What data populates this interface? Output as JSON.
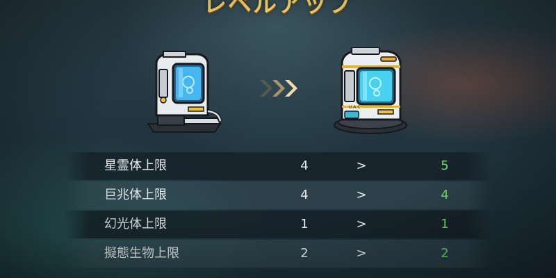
{
  "title": "レベルアップ",
  "icons": {
    "before": "incubator-pod-icon",
    "arrow": "triple-chevron-right-icon",
    "after": "incubator-pod-upgraded-icon"
  },
  "pod_label": "U.A.C",
  "colors": {
    "title": "#f6d36a",
    "increase": "#6fe06a",
    "text": "#e8ecef"
  },
  "stats": [
    {
      "label": "星霊体上限",
      "from": "4",
      "sep": ">",
      "to": "5"
    },
    {
      "label": "巨兆体上限",
      "from": "4",
      "sep": ">",
      "to": "4"
    },
    {
      "label": "幻光体上限",
      "from": "1",
      "sep": ">",
      "to": "1"
    },
    {
      "label": "擬態生物上限",
      "from": "2",
      "sep": ">",
      "to": "2"
    }
  ]
}
